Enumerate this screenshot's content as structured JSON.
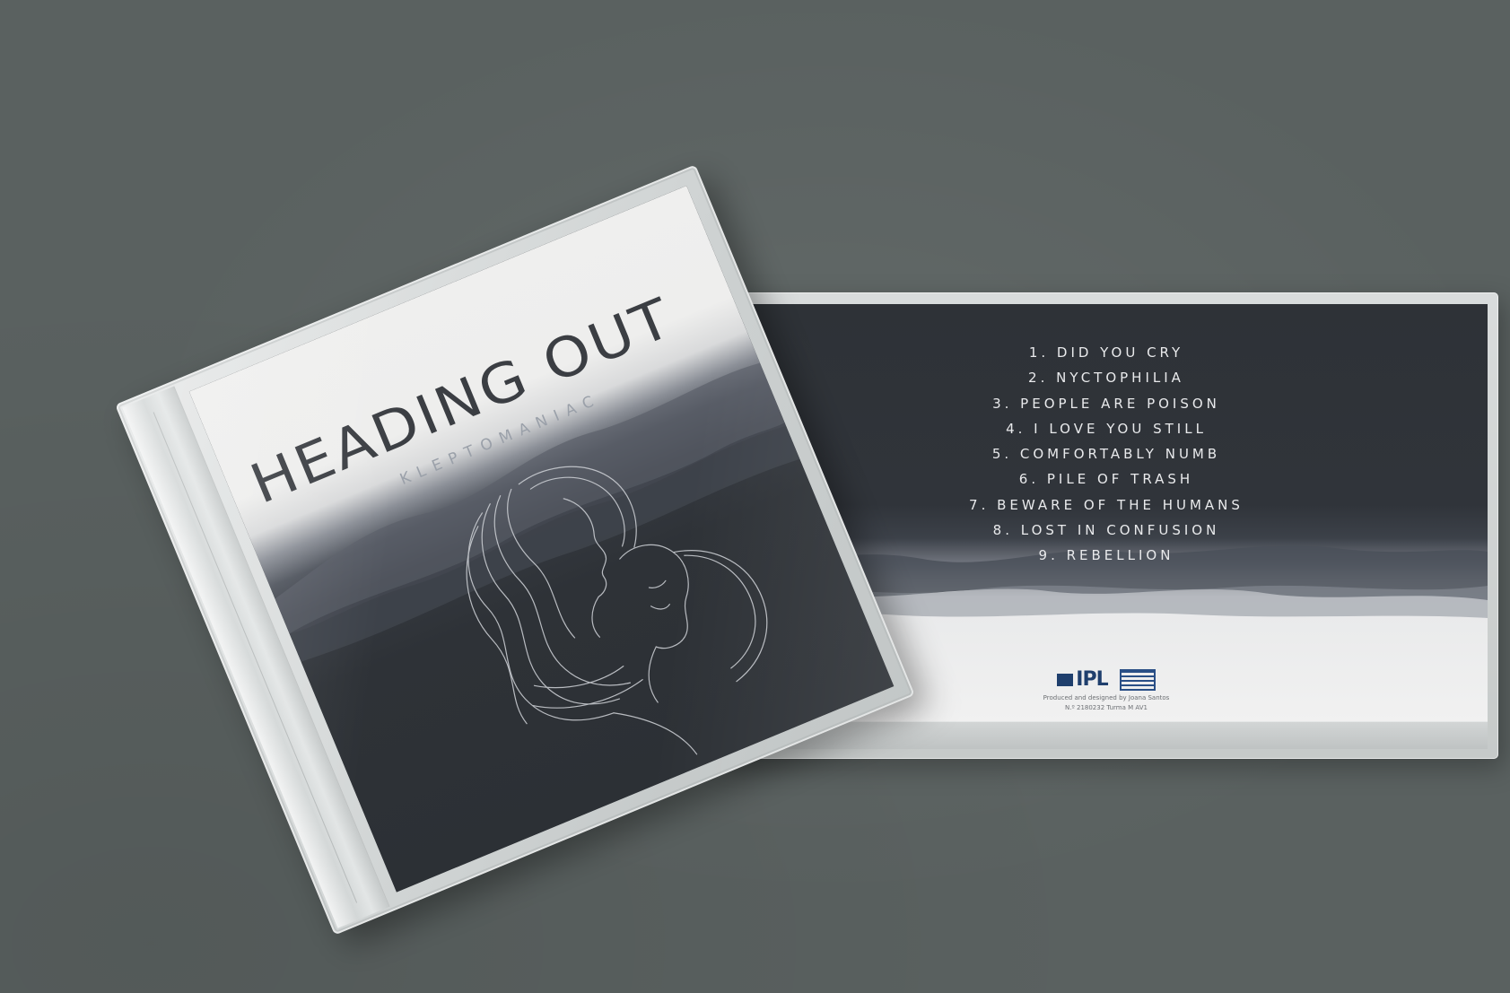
{
  "front_cover": {
    "title": "HEADING OUT",
    "artist": "KLEPTOMANIAC"
  },
  "back_cover": {
    "tracks": [
      "1. DID YOU CRY",
      "2. NYCTOPHILIA",
      "3. PEOPLE ARE POISON",
      "4. I LOVE YOU STILL",
      "5. COMFORTABLY NUMB",
      "6. PILE OF TRASH",
      "7. BEWARE OF THE HUMANS",
      "8. LOST IN CONFUSION",
      "9. REBELLION"
    ],
    "logo_text": "IPL",
    "credit_line_1": "Produced and designed by Joana Santos",
    "credit_line_2": "N.º 2180232 Turma M AV1"
  },
  "colors": {
    "background": "#5a6160",
    "cover_dark": "#2d3136",
    "cover_light": "#efefee",
    "logo_blue": "#1f3f6d"
  },
  "icons": [
    "ipl-logo-icon",
    "school-crest-icon",
    "line-art-illustration"
  ]
}
